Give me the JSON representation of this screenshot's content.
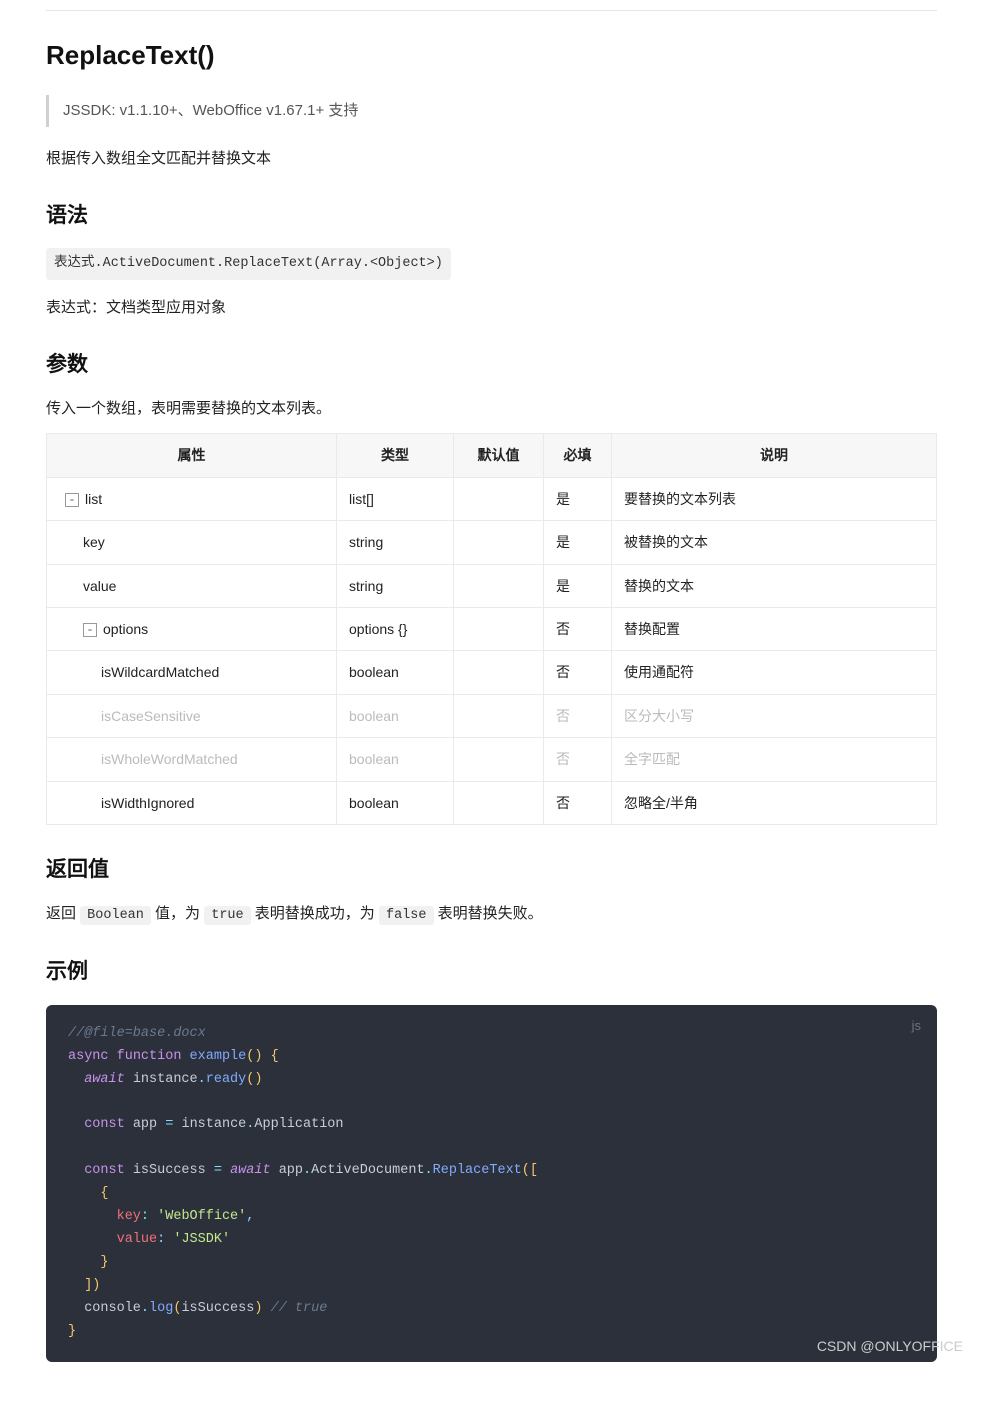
{
  "title": "ReplaceText()",
  "version_note": "JSSDK: v1.1.10+、WebOffice v1.67.1+ 支持",
  "description": "根据传入数组全文匹配并替换文本",
  "sections": {
    "syntax": {
      "heading": "语法",
      "expression": "表达式.ActiveDocument.ReplaceText(Array.<Object>)",
      "note": "表达式：文档类型应用对象"
    },
    "params": {
      "heading": "参数",
      "intro": "传入一个数组，表明需要替换的文本列表。"
    },
    "return": {
      "heading": "返回值",
      "prefix": "返回 ",
      "t_bool": "Boolean",
      "mid1": " 值，为 ",
      "t_true": "true",
      "mid2": " 表明替换成功，为 ",
      "t_false": "false",
      "mid3": " 表明替换失败。"
    },
    "example": {
      "heading": "示例",
      "lang": "js"
    }
  },
  "table": {
    "headers": {
      "prop": "属性",
      "type": "类型",
      "default": "默认值",
      "required": "必填",
      "desc": "说明"
    },
    "rows": [
      {
        "indent": 0,
        "toggle": true,
        "prop": "list",
        "type": "list[]",
        "default": "",
        "required": "是",
        "desc": "要替换的文本列表",
        "disabled": false
      },
      {
        "indent": 1,
        "toggle": false,
        "prop": "key",
        "type": "string",
        "default": "",
        "required": "是",
        "desc": "被替换的文本",
        "disabled": false
      },
      {
        "indent": 1,
        "toggle": false,
        "prop": "value",
        "type": "string",
        "default": "",
        "required": "是",
        "desc": "替换的文本",
        "disabled": false
      },
      {
        "indent": 1,
        "toggle": true,
        "prop": "options",
        "type": "options {}",
        "default": "",
        "required": "否",
        "desc": "替换配置",
        "disabled": false
      },
      {
        "indent": 2,
        "toggle": false,
        "prop": "isWildcardMatched",
        "type": "boolean",
        "default": "",
        "required": "否",
        "desc": "使用通配符",
        "disabled": false
      },
      {
        "indent": 2,
        "toggle": false,
        "prop": "isCaseSensitive",
        "type": "boolean",
        "default": "",
        "required": "否",
        "desc": "区分大小写",
        "disabled": true
      },
      {
        "indent": 2,
        "toggle": false,
        "prop": "isWholeWordMatched",
        "type": "boolean",
        "default": "",
        "required": "否",
        "desc": "全字匹配",
        "disabled": true
      },
      {
        "indent": 2,
        "toggle": false,
        "prop": "isWidthIgnored",
        "type": "boolean",
        "default": "",
        "required": "否",
        "desc": "忽略全/半角",
        "disabled": false
      }
    ]
  },
  "code": {
    "c_file": "//@file=base.docx",
    "kw_async": "async",
    "kw_function": "function",
    "fn_example": "example",
    "kw_await1": "await",
    "id_instance1": "instance",
    "m_ready": "ready",
    "kw_const": "const",
    "id_app": "app",
    "id_instance2": "instance",
    "m_app": "Application",
    "id_isSuccess": "isSuccess",
    "kw_await2": "await",
    "id_app2": "app",
    "m_active": "ActiveDocument",
    "m_replace": "ReplaceText",
    "p_key": "key",
    "s_web": "'WebOffice'",
    "p_value": "value",
    "s_jssdk": "'JSSDK'",
    "id_console": "console",
    "m_log": "log",
    "id_isSuccess2": "isSuccess",
    "c_true": "// true"
  },
  "watermark": "CSDN @ONLYOFFICE"
}
